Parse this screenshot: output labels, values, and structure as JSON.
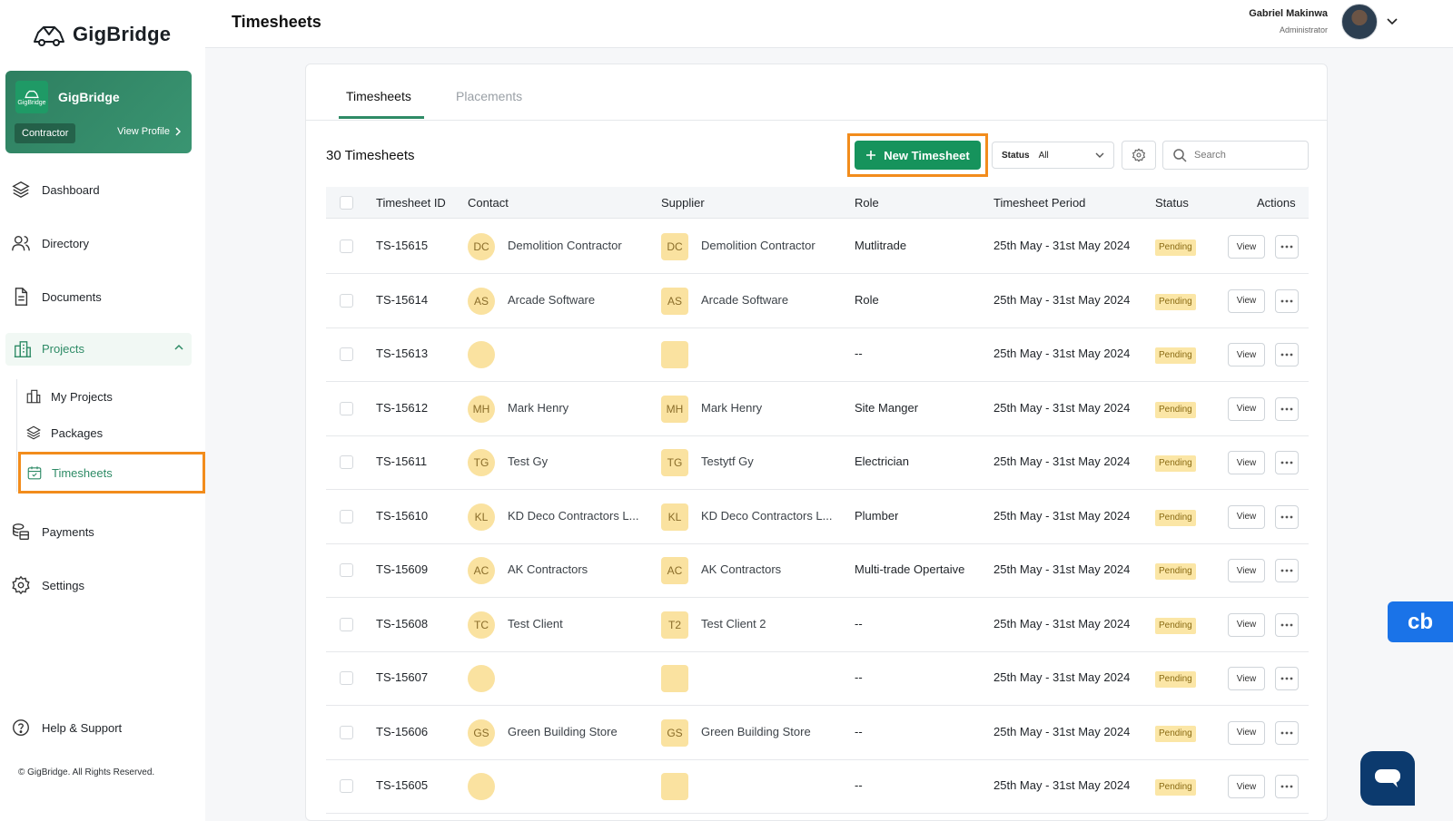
{
  "brand": {
    "name": "GigBridge"
  },
  "org_card": {
    "logo_text": "GigBridge",
    "name": "GigBridge",
    "role": "Contractor",
    "view_profile": "View Profile"
  },
  "nav": {
    "dashboard": "Dashboard",
    "directory": "Directory",
    "documents": "Documents",
    "projects": "Projects",
    "my_projects": "My Projects",
    "packages": "Packages",
    "timesheets": "Timesheets",
    "payments": "Payments",
    "settings": "Settings",
    "help": "Help & Support"
  },
  "footer": {
    "copyright": "© GigBridge. All Rights Reserved."
  },
  "header": {
    "title": "Timesheets",
    "user_name": "Gabriel Makinwa",
    "user_role": "Administrator"
  },
  "tabs": [
    {
      "label": "Timesheets"
    },
    {
      "label": "Placements"
    }
  ],
  "toolbar": {
    "count_label": "30 Timesheets",
    "new_button": "New Timesheet",
    "status_label": "Status",
    "status_value": "All",
    "search_placeholder": "Search"
  },
  "table": {
    "columns": [
      "Timesheet ID",
      "Contact",
      "Supplier",
      "Role",
      "Timesheet Period",
      "Status",
      "Actions"
    ],
    "view_label": "View",
    "rows": [
      {
        "id": "TS-15615",
        "contact_initials": "DC",
        "contact": "Demolition Contractor",
        "supplier_initials": "DC",
        "supplier": "Demolition Contractor",
        "role": "Mutlitrade",
        "period": "25th May - 31st May 2024",
        "status": "Pending"
      },
      {
        "id": "TS-15614",
        "contact_initials": "AS",
        "contact": "Arcade Software",
        "supplier_initials": "AS",
        "supplier": "Arcade Software",
        "role": "Role",
        "period": "25th May - 31st May 2024",
        "status": "Pending"
      },
      {
        "id": "TS-15613",
        "contact_initials": "",
        "contact": "",
        "supplier_initials": "",
        "supplier": "",
        "role": "--",
        "period": "25th May - 31st May 2024",
        "status": "Pending"
      },
      {
        "id": "TS-15612",
        "contact_initials": "MH",
        "contact": "Mark Henry",
        "supplier_initials": "MH",
        "supplier": "Mark Henry",
        "role": "Site Manger",
        "period": "25th May - 31st May 2024",
        "status": "Pending"
      },
      {
        "id": "TS-15611",
        "contact_initials": "TG",
        "contact": "Test Gy",
        "supplier_initials": "TG",
        "supplier": "Testytf Gy",
        "role": "Electrician",
        "period": "25th May - 31st May 2024",
        "status": "Pending"
      },
      {
        "id": "TS-15610",
        "contact_initials": "KL",
        "contact": "KD Deco Contractors L...",
        "supplier_initials": "KL",
        "supplier": "KD Deco Contractors L...",
        "role": "Plumber",
        "period": "25th May - 31st May 2024",
        "status": "Pending"
      },
      {
        "id": "TS-15609",
        "contact_initials": "AC",
        "contact": "AK Contractors",
        "supplier_initials": "AC",
        "supplier": "AK Contractors",
        "role": "Multi-trade Opertaive",
        "period": "25th May - 31st May 2024",
        "status": "Pending"
      },
      {
        "id": "TS-15608",
        "contact_initials": "TC",
        "contact": "Test Client",
        "supplier_initials": "T2",
        "supplier": "Test Client 2",
        "role": "--",
        "period": "25th May - 31st May 2024",
        "status": "Pending"
      },
      {
        "id": "TS-15607",
        "contact_initials": "",
        "contact": "",
        "supplier_initials": "",
        "supplier": "",
        "role": "--",
        "period": "25th May - 31st May 2024",
        "status": "Pending"
      },
      {
        "id": "TS-15606",
        "contact_initials": "GS",
        "contact": "Green Building Store",
        "supplier_initials": "GS",
        "supplier": "Green Building Store",
        "role": "--",
        "period": "25th May - 31st May 2024",
        "status": "Pending"
      },
      {
        "id": "TS-15605",
        "contact_initials": "",
        "contact": "",
        "supplier_initials": "",
        "supplier": "",
        "role": "--",
        "period": "25th May - 31st May 2024",
        "status": "Pending"
      }
    ]
  },
  "widgets": {
    "cb_label": "cb"
  },
  "colors": {
    "primary": "#16935c",
    "accent_highlight": "#f28c1c",
    "badge_bg": "#fbe6a6",
    "avatar_bg": "#fae2a0"
  }
}
